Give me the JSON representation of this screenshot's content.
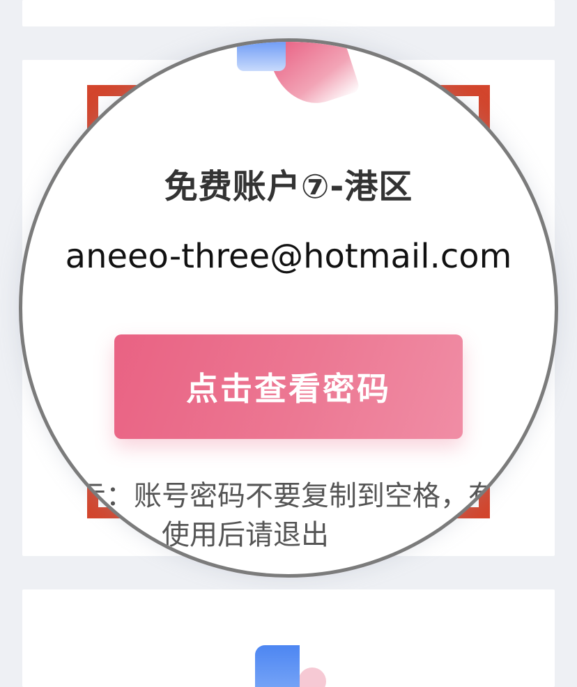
{
  "account_card": {
    "title": "免费账户⑦-港区",
    "email": "aneeo-three@hotmail.com",
    "view_password_label": "点击查看密码",
    "tip": "提示：账号密码不要复制到空格，有错请反馈，使用后请退出"
  },
  "colors": {
    "accent_pink": "#e96283",
    "corner_red": "#d3452c",
    "logo_blue": "#4d86f2",
    "magnifier_ring": "#7b7b7b"
  }
}
